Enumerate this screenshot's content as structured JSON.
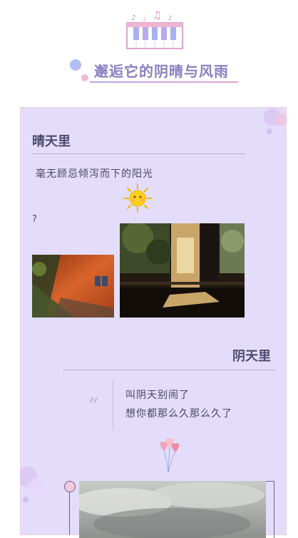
{
  "header": {
    "title": "邂逅它的阴晴与风雨"
  },
  "sunny_section": {
    "title": "晴天里",
    "text": "毫无顾忌倾泻而下的阳光",
    "stray_mark": "?"
  },
  "cloudy_section": {
    "title": "阴天里",
    "quote_mark": "“",
    "lines": [
      "叫阴天别闹了",
      "想你都那么久那么久了"
    ]
  },
  "icons": {
    "header": "piano-music-icon",
    "sun": "sun-icon",
    "balloon": "heart-balloons-icon"
  },
  "colors": {
    "card_bg": "#e3ddfb",
    "title_purple": "#8a7fc0",
    "heading": "#4d4a6b",
    "accent_pink": "#e3a2cf"
  }
}
